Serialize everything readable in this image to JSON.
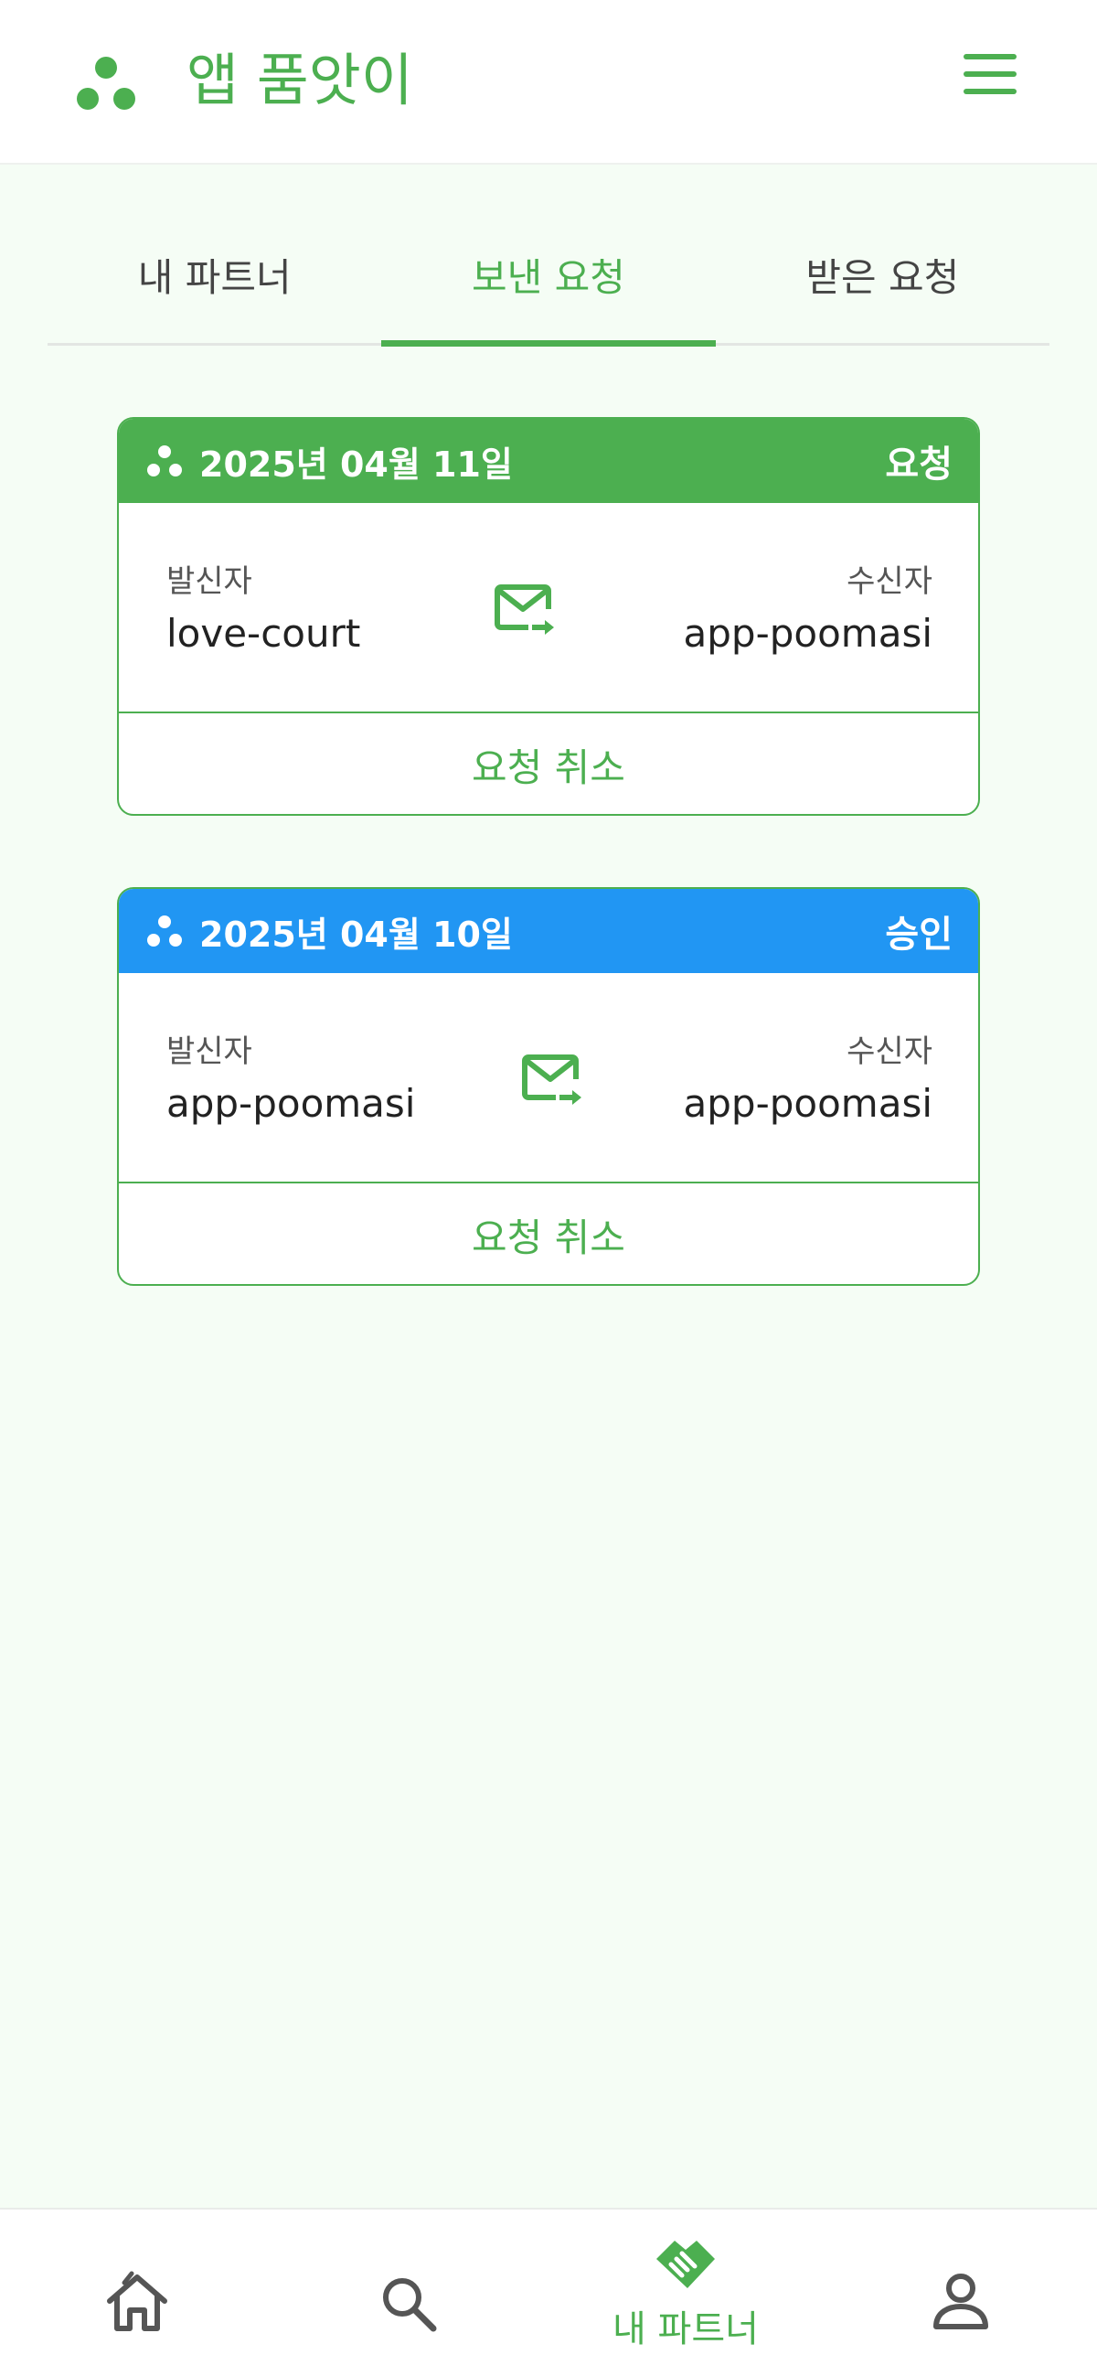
{
  "header": {
    "title": "앱 품앗이",
    "logo_icon": "three-dots-logo-icon",
    "menu_icon": "hamburger-menu-icon"
  },
  "tabs": [
    {
      "label": "내 파트너",
      "active": false
    },
    {
      "label": "보낸 요청",
      "active": true
    },
    {
      "label": "받은 요청",
      "active": false
    }
  ],
  "requests": [
    {
      "date": "2025년 04월 11일",
      "status": "요청",
      "status_color": "#4caf50",
      "sender_label": "발신자",
      "sender": "love-court",
      "receiver_label": "수신자",
      "receiver": "app-poomasi",
      "action_label": "요청 취소"
    },
    {
      "date": "2025년 04월 10일",
      "status": "승인",
      "status_color": "#2196f3",
      "sender_label": "발신자",
      "sender": "app-poomasi",
      "receiver_label": "수신자",
      "receiver": "app-poomasi",
      "action_label": "요청 취소"
    }
  ],
  "bottom_nav": {
    "items": [
      {
        "icon": "home-icon",
        "label": ""
      },
      {
        "icon": "search-icon",
        "label": ""
      },
      {
        "icon": "handshake-icon",
        "label": "내 파트너",
        "active": true
      },
      {
        "icon": "profile-icon",
        "label": ""
      }
    ]
  },
  "colors": {
    "primary": "#4caf50",
    "approved": "#2196f3",
    "background": "#f5fdf5"
  }
}
